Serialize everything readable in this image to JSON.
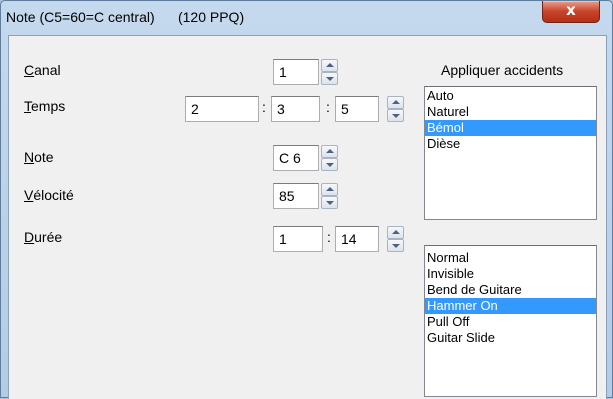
{
  "window": {
    "title": "Note (C5=60=C central)      (120 PPQ)",
    "close_glyph": "x"
  },
  "fields": {
    "canal": {
      "label_ul": "C",
      "label_rest": "anal",
      "value": "1"
    },
    "temps": {
      "label_ul": "T",
      "label_rest": "emps",
      "values": [
        "2",
        "3",
        "5"
      ],
      "sep": ":"
    },
    "note": {
      "label_ul": "N",
      "label_rest": "ote",
      "value": "C 6"
    },
    "velocite": {
      "label_ul": "V",
      "label_rest": "élocité",
      "value": "85"
    },
    "duree": {
      "label_ul": "D",
      "label_rest": "urée",
      "values": [
        "1",
        "14"
      ],
      "sep": ":"
    }
  },
  "accidents": {
    "heading": "Appliquer accidents",
    "items": [
      "Auto",
      "Naturel",
      "Bémol",
      "Dièse"
    ],
    "selected": "Bémol"
  },
  "styles": {
    "items": [
      "Normal",
      "Invisible",
      "Bend de Guitare",
      "Hammer On",
      "Pull Off",
      "Guitar Slide"
    ],
    "selected": "Hammer On"
  },
  "colors": {
    "selection": "#3399ff",
    "dialog_bg": "#f0f0f0",
    "titlebar": "#b3cbe4",
    "close_button": "#c7432a"
  }
}
